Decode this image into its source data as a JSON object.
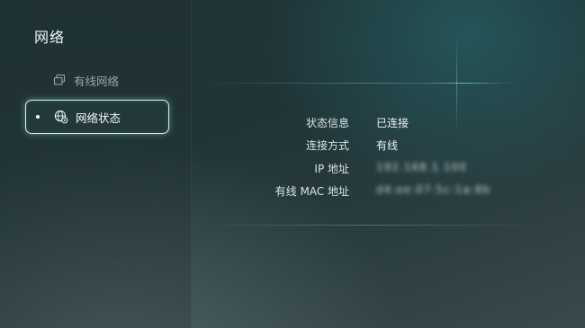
{
  "header": {
    "title": "网络"
  },
  "sidebar": {
    "items": [
      {
        "label": "有线网络",
        "icon": "wired-network-icon",
        "selected": false
      },
      {
        "label": "网络状态",
        "icon": "globe-settings-icon",
        "selected": true
      }
    ]
  },
  "status": {
    "rows": [
      {
        "label": "状态信息",
        "value": "已连接",
        "obscured": false
      },
      {
        "label": "连接方式",
        "value": "有线",
        "obscured": false
      },
      {
        "label": "IP 地址",
        "value": "192.168.1.100",
        "obscured": true
      },
      {
        "label": "有线 MAC 地址",
        "value": "d4:ee:07:5c:1a:8b",
        "obscured": true
      }
    ]
  },
  "colors": {
    "focus_border": "#d9f0f2",
    "accent_glow": "#78dce1"
  }
}
